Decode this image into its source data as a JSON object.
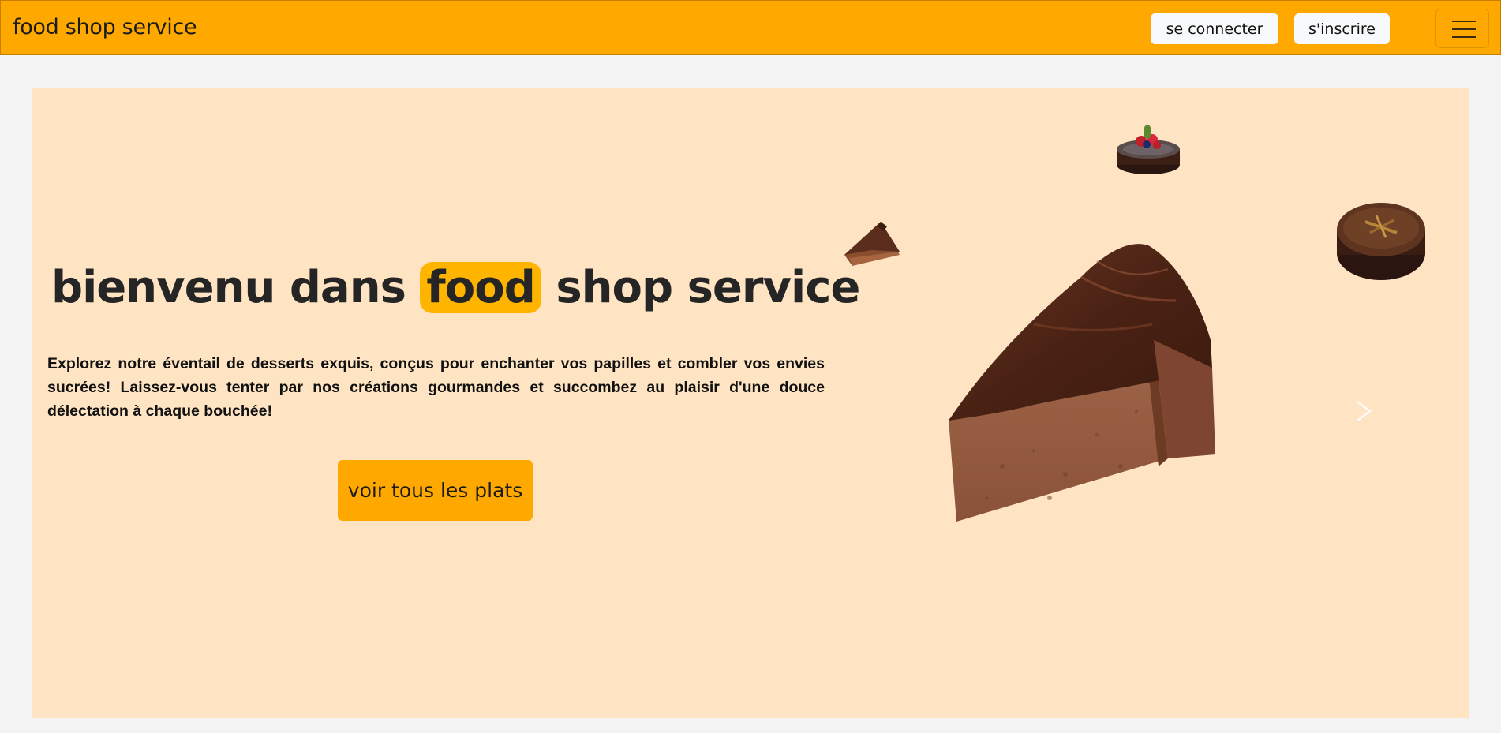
{
  "navbar": {
    "brand": "food shop service",
    "login_label": "se connecter",
    "signup_label": "s'inscrire",
    "menu_icon": "hamburger-menu-icon"
  },
  "hero": {
    "title_before": "bienvenu dans ",
    "title_highlight": "food",
    "title_after": " shop service",
    "description": "Explorez notre éventail de desserts exquis, conçus pour enchanter vos papilles et combler vos envies sucrées! Laissez-vous tenter par nos créations gourmandes et succombez au plaisir d'une douce délectation à chaque bouchée!",
    "cta_label": "voir tous les plats",
    "next_icon": "chevron-right-icon"
  },
  "colors": {
    "navbar": "#ffa800",
    "hero_bg": "#ffe4c3",
    "highlight": "#ffb400",
    "page_bg": "#f3f3f3"
  }
}
